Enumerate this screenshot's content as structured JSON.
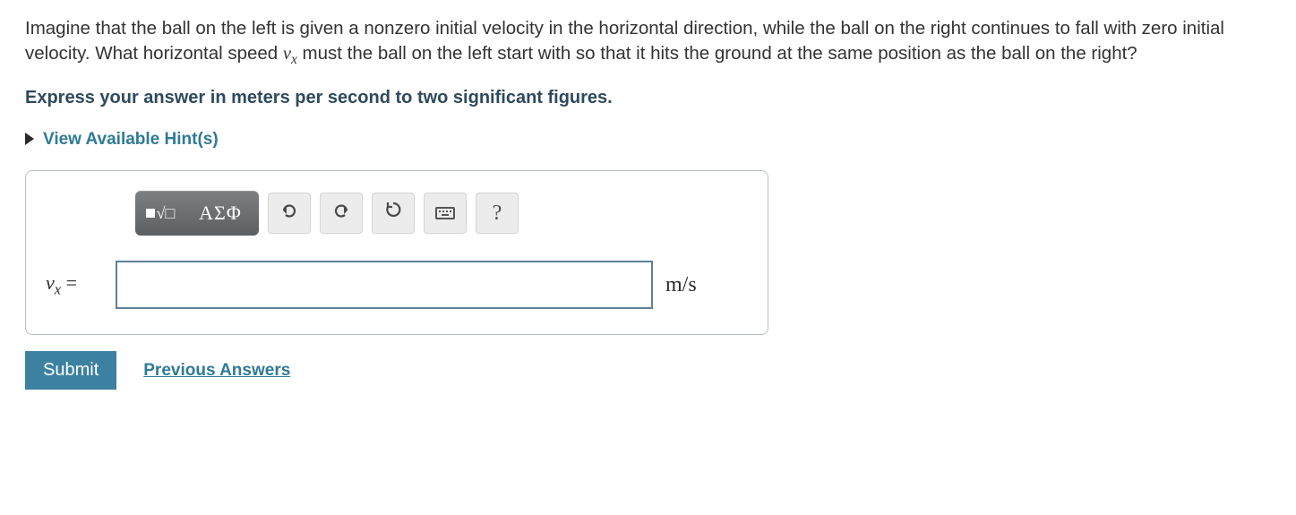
{
  "question": {
    "prefix": "Imagine that the ball on the left is given a nonzero initial velocity in the horizontal direction, while the ball on the right continues to fall with zero initial velocity. What horizontal speed ",
    "variable_v": "v",
    "variable_sub": "x",
    "suffix": " must the ball on the left start with so that it hits the ground at the same position as the ball on the right?"
  },
  "instruction": "Express your answer in meters per second to two significant figures.",
  "hints_label": "View Available Hint(s)",
  "toolbar": {
    "format_btn": "format",
    "greek_btn": "ΑΣΦ",
    "undo_btn": "↶",
    "redo_btn": "↷",
    "reset_btn": "↻",
    "keyboard_btn": "keyboard",
    "help_btn": "?"
  },
  "answer": {
    "lhs_v": "v",
    "lhs_sub": "x",
    "lhs_eq": " =",
    "value": "",
    "unit": "m/s"
  },
  "actions": {
    "submit": "Submit",
    "previous": "Previous Answers"
  }
}
